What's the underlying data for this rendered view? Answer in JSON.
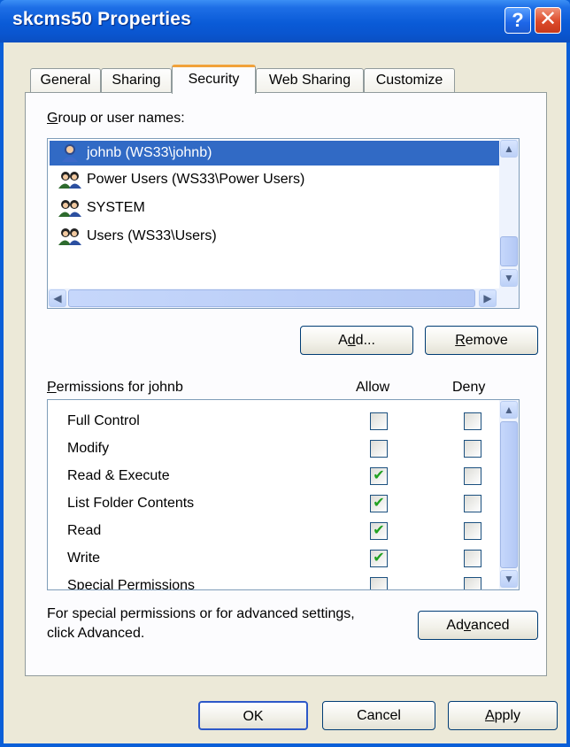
{
  "window": {
    "title": "skcms50 Properties"
  },
  "tabs": [
    "General",
    "Sharing",
    "Security",
    "Web Sharing",
    "Customize"
  ],
  "groups": {
    "label_prefix": "G",
    "label_rest": "roup or user names:",
    "items": [
      {
        "name": "johnb (WS33\\johnb)",
        "selected": true,
        "icon": "user-icon"
      },
      {
        "name": "Power Users (WS33\\Power Users)",
        "selected": false,
        "icon": "group-icon"
      },
      {
        "name": "SYSTEM",
        "selected": false,
        "icon": "group-icon"
      },
      {
        "name": "Users (WS33\\Users)",
        "selected": false,
        "icon": "group-icon"
      }
    ]
  },
  "buttons": {
    "add_pre": "A",
    "add_mnemonic": "d",
    "add_post": "d...",
    "remove_mnemonic": "R",
    "remove_post": "emove",
    "advanced_pre": "Ad",
    "advanced_mnemonic": "v",
    "advanced_post": "anced",
    "ok": "OK",
    "cancel": "Cancel",
    "apply_mnemonic": "A",
    "apply_post": "pply"
  },
  "permissions": {
    "label_mnemonic": "P",
    "label_rest": "ermissions for johnb",
    "allow_header": "Allow",
    "deny_header": "Deny",
    "items": [
      {
        "name": "Full Control",
        "allow": false,
        "deny": false
      },
      {
        "name": "Modify",
        "allow": false,
        "deny": false
      },
      {
        "name": "Read & Execute",
        "allow": true,
        "deny": false
      },
      {
        "name": "List Folder Contents",
        "allow": true,
        "deny": false
      },
      {
        "name": "Read",
        "allow": true,
        "deny": false
      },
      {
        "name": "Write",
        "allow": true,
        "deny": false
      },
      {
        "name": "Special Permissions",
        "allow": false,
        "deny": false
      }
    ]
  },
  "advanced_note": {
    "line1": "For special permissions or for advanced settings,",
    "line2": "click Advanced."
  },
  "colors": {
    "titlebar": "#0a5bd7",
    "selection": "#316ac5",
    "dialog": "#ece9d8",
    "check": "#21a121"
  }
}
